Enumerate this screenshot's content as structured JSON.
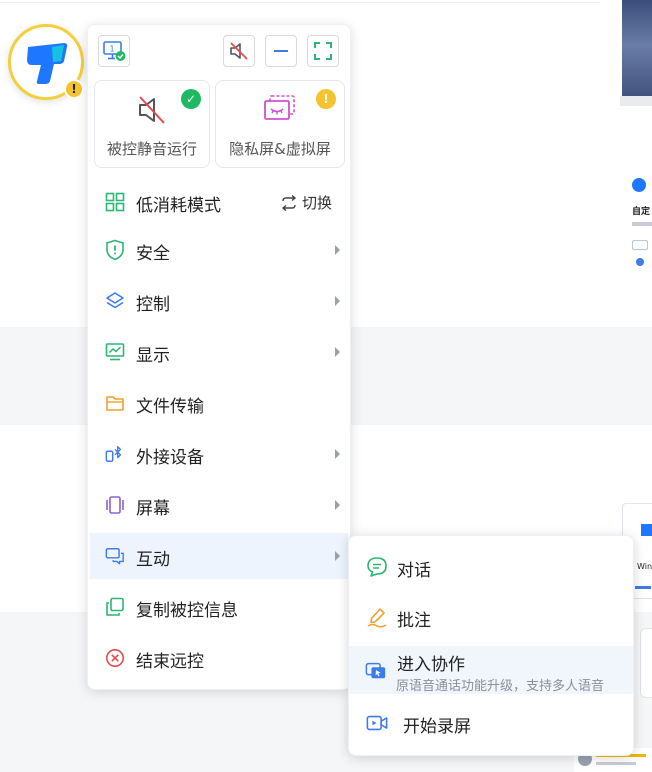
{
  "colors": {
    "accent": "#1e78ff",
    "ok": "#1fb964",
    "warn": "#f4c430",
    "danger": "#e34b4b",
    "green_icon": "#2bb673",
    "orange_icon": "#f0a030",
    "purple_icon": "#8a63d2",
    "pink_icon": "#d34fd0"
  },
  "background_page": {
    "card_title": "自定",
    "windows_label": "Win"
  },
  "floating_button": {
    "logo_icon": "todesk-logo-icon",
    "warning_badge": "!"
  },
  "toolbar": {
    "monitor_icon": "monitor-number-icon",
    "monitor_index": "1",
    "mute_icon": "speaker-muted-icon",
    "minimize_icon": "minimize-icon",
    "fullscreen_icon": "fullscreen-icon"
  },
  "quick_cards": [
    {
      "label": "被控静音运行",
      "icon": "speaker-muted-icon",
      "status": "ok"
    },
    {
      "label": "隐私屏&虚拟屏",
      "icon": "privacy-screen-icon",
      "status": "warn"
    }
  ],
  "menu": {
    "items": [
      {
        "label": "低消耗模式",
        "icon": "grid-icon",
        "action_label": "切换"
      },
      {
        "label": "安全",
        "icon": "shield-icon",
        "has_submenu": true
      },
      {
        "label": "控制",
        "icon": "layers-icon",
        "has_submenu": true
      },
      {
        "label": "显示",
        "icon": "display-chart-icon",
        "has_submenu": true
      },
      {
        "label": "文件传输",
        "icon": "folder-icon",
        "has_submenu": false
      },
      {
        "label": "外接设备",
        "icon": "bluetooth-device-icon",
        "has_submenu": true
      },
      {
        "label": "屏幕",
        "icon": "screen-icon",
        "has_submenu": true
      },
      {
        "label": "互动",
        "icon": "chat-bubble-icon",
        "has_submenu": true,
        "active": true
      },
      {
        "label": "复制被控信息",
        "icon": "copy-icon",
        "has_submenu": false
      },
      {
        "label": "结束远控",
        "icon": "close-circle-icon",
        "has_submenu": false
      }
    ]
  },
  "submenu": {
    "items": [
      {
        "label": "对话",
        "icon": "chat-icon"
      },
      {
        "label": "批注",
        "icon": "pen-icon"
      },
      {
        "label": "进入协作",
        "icon": "collaboration-icon",
        "description": "原语音通话功能升级，支持多人语音"
      },
      {
        "label": "开始录屏",
        "icon": "video-record-icon"
      }
    ]
  }
}
